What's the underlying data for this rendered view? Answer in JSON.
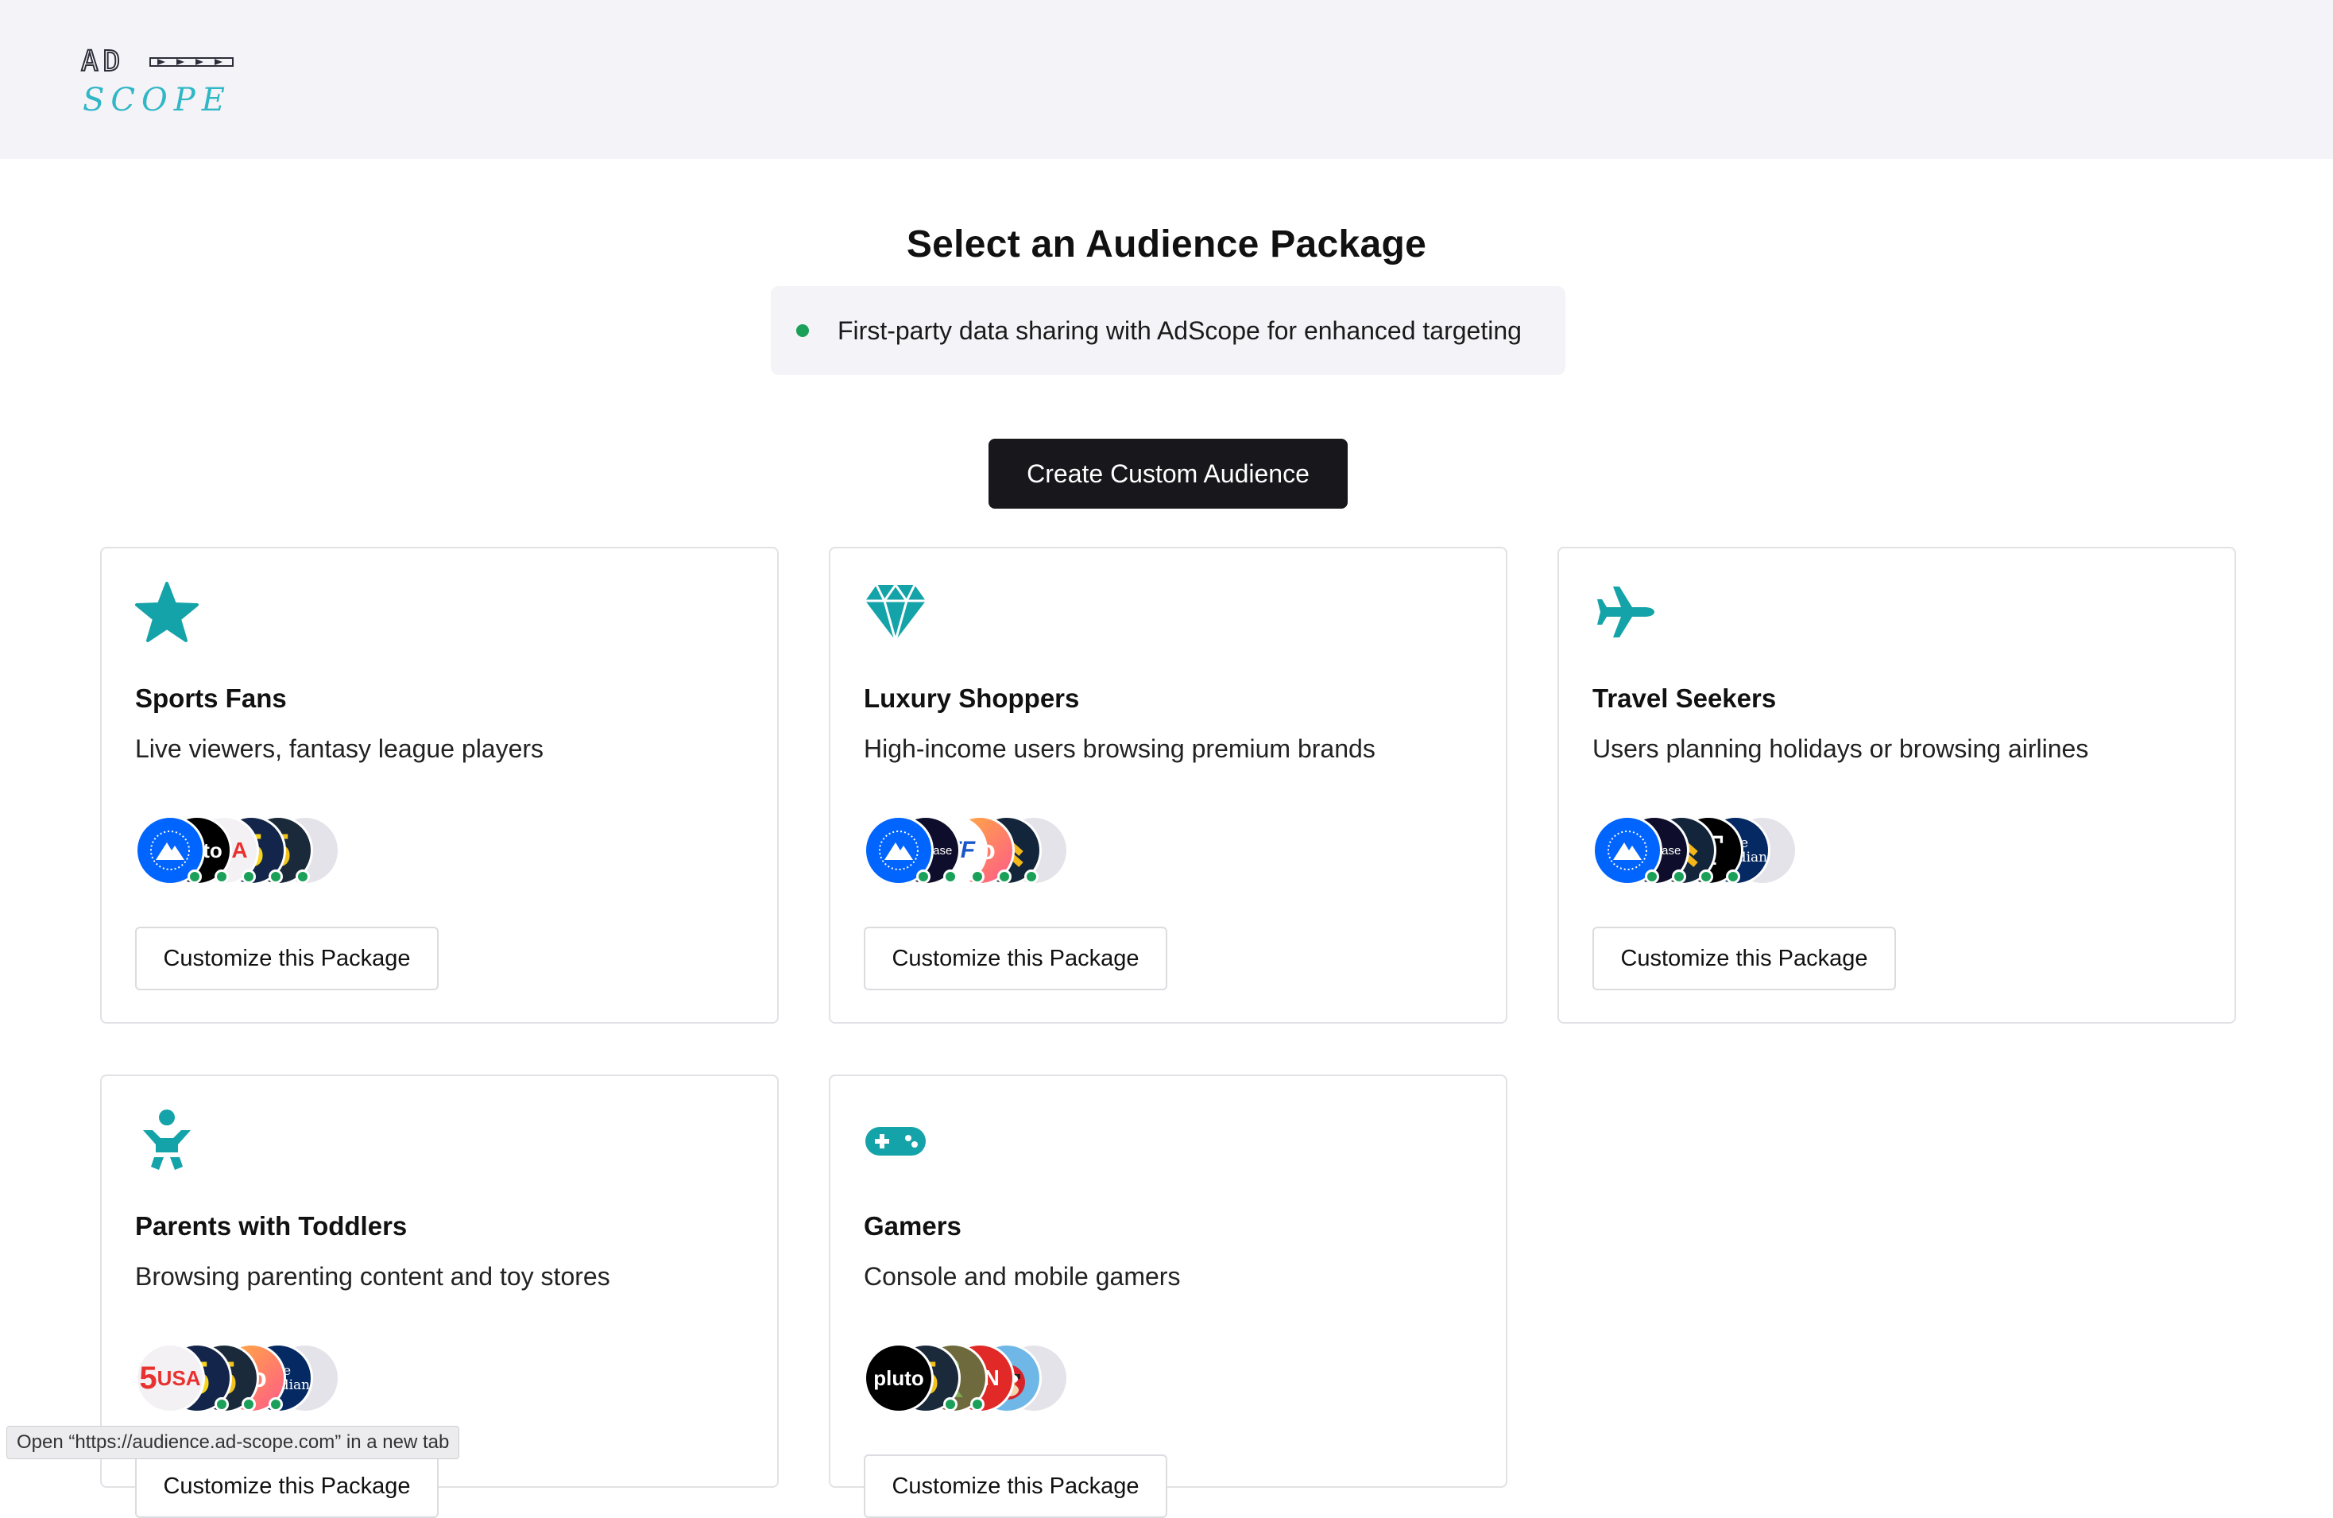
{
  "header": {
    "logo_top": "AD",
    "logo_bottom": "SCOPE"
  },
  "page": {
    "title": "Select an Audience Package",
    "notice": "First-party data sharing with AdScope for enhanced targeting",
    "notice_status_color": "#1aa058",
    "create_button": "Create Custom Audience"
  },
  "colors": {
    "accent": "#14a3a8",
    "primary_button": "#17171c",
    "live": "#1aa058"
  },
  "packages": [
    {
      "icon": "star-icon",
      "name": "Sports Fans",
      "description": "Live viewers, fantasy league players",
      "publishers": [
        "paramount",
        "pluto",
        "usa",
        "channel5",
        "5star"
      ],
      "more": "+",
      "button": "Customize this Package"
    },
    {
      "icon": "gem-icon",
      "name": "Luxury Shoppers",
      "description": "High-income users browsing premium brands",
      "publishers": [
        "paramount",
        "showcase",
        "atf",
        "lio",
        "chevron-brand"
      ],
      "more": "+",
      "button": "Customize this Package"
    },
    {
      "icon": "airplane-icon",
      "name": "Travel Seekers",
      "description": "Users planning holidays or browsing airlines",
      "publishers": [
        "paramount",
        "showcase",
        "chevron-brand",
        "nytimes",
        "guardian"
      ],
      "more": "+",
      "button": "Customize this Package"
    },
    {
      "icon": "baby-icon",
      "name": "Parents with Toddlers",
      "description": "Browsing parenting content and toy stores",
      "publishers": [
        "usa",
        "channel5",
        "5star",
        "lio",
        "guardian"
      ],
      "more": "+",
      "button": "Customize this Package"
    },
    {
      "icon": "gamepad-icon",
      "name": "Gamers",
      "description": "Console and mobile gamers",
      "publishers": [
        "pluto",
        "5star",
        "chess",
        "ign",
        "angry-birds"
      ],
      "more": "+",
      "button": "Customize this Package"
    }
  ],
  "publisher_marks": {
    "pluto": "pluto",
    "usa": "USA",
    "usa_prefix": "5",
    "channel5": "5",
    "5star": "5",
    "showcase": "showcase",
    "atf": "ATF",
    "lio": "lio",
    "nytimes": "T",
    "guardian": "The Guardian",
    "ign": "IGN"
  },
  "statusbar": {
    "link_preview": "Open “https://audience.ad-scope.com” in a new tab"
  }
}
